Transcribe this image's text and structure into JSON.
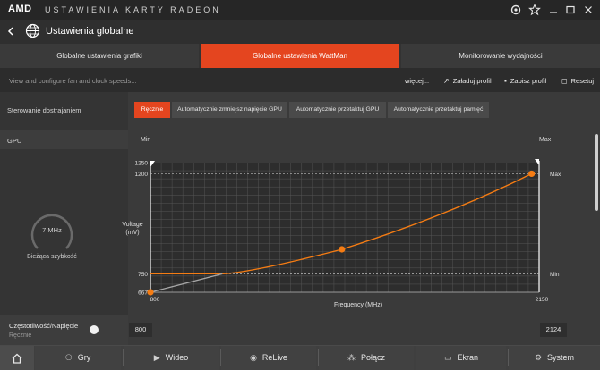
{
  "titlebar": {
    "brand": "AMD",
    "title": "USTAWIENIA KARTY RADEON",
    "icons": [
      "refresh-icon",
      "star-icon",
      "minimize-icon",
      "maximize-icon",
      "close-icon"
    ]
  },
  "header": {
    "title": "Ustawienia globalne"
  },
  "tabs": [
    {
      "label": "Globalne ustawienia grafiki"
    },
    {
      "label": "Globalne ustawienia WattMan"
    },
    {
      "label": "Monitorowanie wydajności"
    }
  ],
  "subheader": {
    "description": "View and configure fan and clock speeds...",
    "more": "więcej...",
    "load_profile": "Załaduj profil",
    "save_profile": "Zapisz profil",
    "reset": "Resetuj"
  },
  "left": {
    "control_label": "Sterowanie dostrajaniem",
    "gpu_label": "GPU",
    "gauge_value": "7 MHz",
    "gauge_label": "Bieżąca szybkość",
    "freq_volt_label": "Częstotliwość/Napięcie",
    "freq_volt_mode": "Ręcznie"
  },
  "modes": [
    {
      "label": "Ręcznie"
    },
    {
      "label": "Automatycznie zmniejsz napięcie GPU"
    },
    {
      "label": "Automatycznie przetaktuj GPU"
    },
    {
      "label": "Automatycznie przetaktuj pamięć"
    }
  ],
  "range": {
    "min_label": "Min",
    "max_label": "Max",
    "min_value": "800",
    "max_value": "2124"
  },
  "chart_data": {
    "type": "line",
    "xlabel": "Frequency (MHz)",
    "ylabel": "Voltage\n(mV)",
    "x_ticks": [
      "800",
      "2150"
    ],
    "y_ticks": [
      "1250",
      "1200",
      "750",
      "667"
    ],
    "right_labels": [
      "Max",
      "Min"
    ],
    "xlim": [
      800,
      2150
    ],
    "ylim": [
      667,
      1250
    ],
    "min_voltage": 750,
    "max_voltage": 1200,
    "series": [
      {
        "values_x": [
          800,
          1465,
          2124
        ],
        "values_y": [
          667,
          860,
          1200
        ]
      }
    ],
    "colors": {
      "curve": "#f57c13",
      "grid": "#555555",
      "bg": "#2d2d2d"
    }
  },
  "nav": [
    {
      "icon": "home-icon",
      "label": ""
    },
    {
      "icon": "gamepad-icon",
      "label": "Gry"
    },
    {
      "icon": "video-icon",
      "label": "Wideo"
    },
    {
      "icon": "relive-icon",
      "label": "ReLive"
    },
    {
      "icon": "connect-icon",
      "label": "Połącz"
    },
    {
      "icon": "display-icon",
      "label": "Ekran"
    },
    {
      "icon": "system-icon",
      "label": "System"
    }
  ],
  "colors": {
    "accent": "#e4451f",
    "orange_curve": "#f57c13"
  }
}
